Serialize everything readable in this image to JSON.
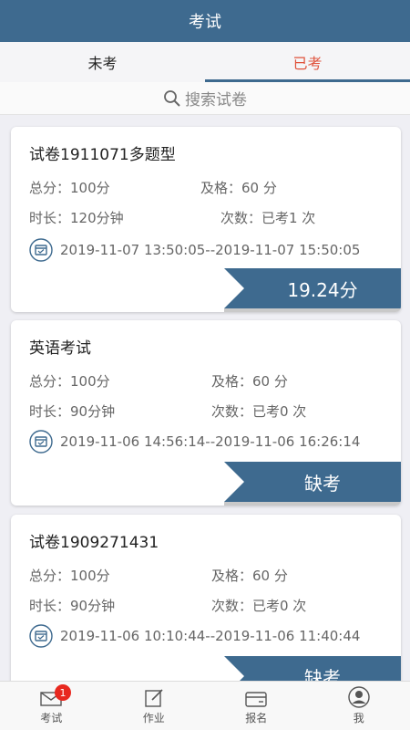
{
  "header": {
    "title": "考试"
  },
  "tabs": [
    {
      "label": "未考"
    },
    {
      "label": "已考"
    }
  ],
  "search": {
    "placeholder": "搜索试卷"
  },
  "exams": [
    {
      "title": "试卷1911071多题型",
      "total_label": "总分：100分",
      "pass_label": "及格：60 分",
      "duration_label": "时长：120分钟",
      "attempts_label": "次数：已考1 次",
      "time_range": "2019-11-07 13:50:05--2019-11-07 15:50:05",
      "result": "19.24分"
    },
    {
      "title": "英语考试",
      "total_label": "总分：100分",
      "pass_label": "及格：60 分",
      "duration_label": "时长：90分钟",
      "attempts_label": "次数：已考0 次",
      "time_range": "2019-11-06 14:56:14--2019-11-06 16:26:14",
      "result": "缺考"
    },
    {
      "title": "试卷1909271431",
      "total_label": "总分：100分",
      "pass_label": "及格：60 分",
      "duration_label": "时长：90分钟",
      "attempts_label": "次数：已考0 次",
      "time_range": "2019-11-06 10:10:44--2019-11-06 11:40:44",
      "result": "缺考"
    }
  ],
  "bottom_nav": [
    {
      "label": "考试",
      "icon": "mail-icon",
      "badge": "1"
    },
    {
      "label": "作业",
      "icon": "edit-icon"
    },
    {
      "label": "报名",
      "icon": "card-icon"
    },
    {
      "label": "我",
      "icon": "user-icon"
    }
  ],
  "colors": {
    "primary": "#3e6a8f",
    "active_tab": "#e0533c",
    "badge": "#e8281f"
  }
}
